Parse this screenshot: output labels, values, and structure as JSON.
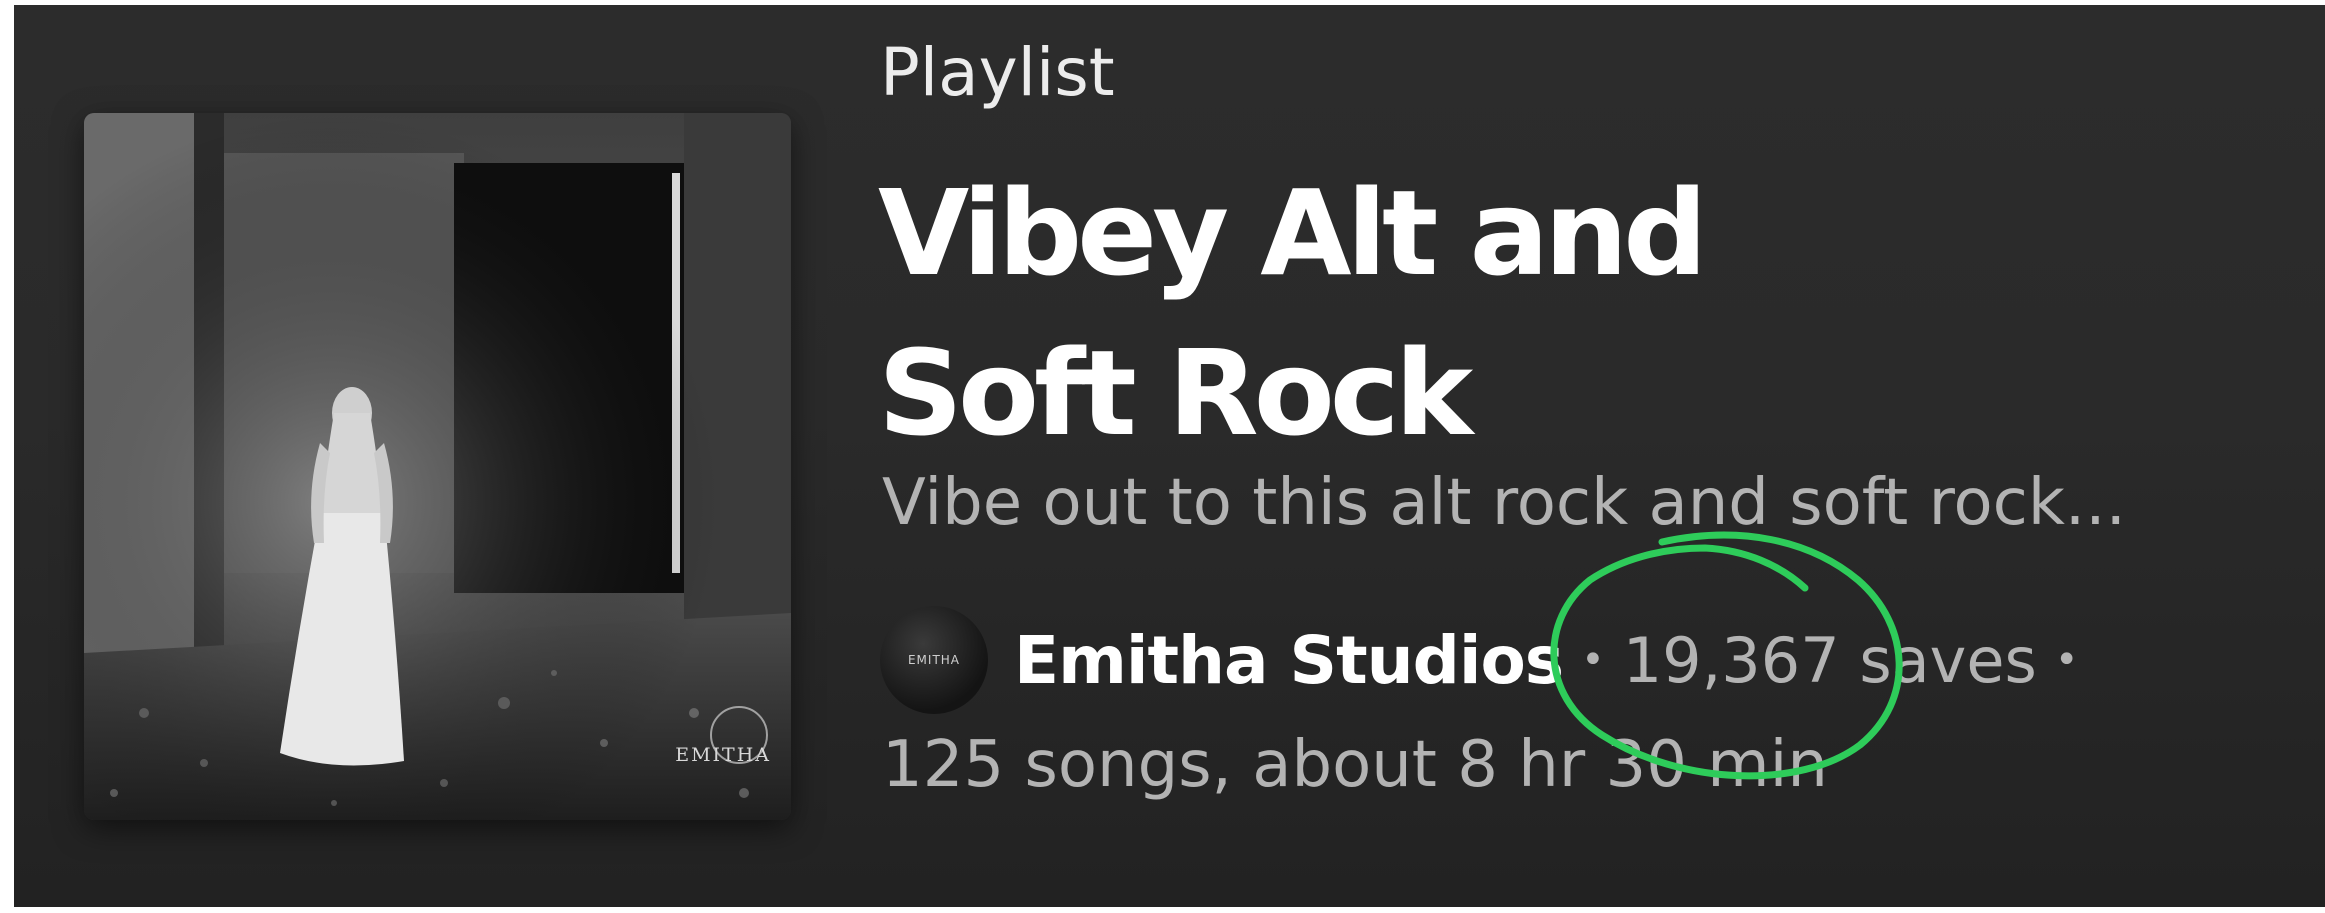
{
  "playlist": {
    "type_label": "Playlist",
    "title": "Vibey Alt and Soft Rock",
    "description": "Vibe out to this alt rock and soft rock...",
    "cover_brand": "EMITHA",
    "owner": {
      "avatar_text": "EMITHA",
      "name": "Emitha Studios"
    },
    "separator": "•",
    "saves": "19,367",
    "saves_unit": "saves",
    "songs_summary": "125 songs, about 8 hr 30 min"
  },
  "colors": {
    "annotation_circle": "#2ecc5a",
    "background": "#2a2a2a",
    "title_text": "#ffffff",
    "secondary_text": "#b3b3b3"
  },
  "icons": {
    "annotation": "hand-drawn-circle-icon"
  }
}
